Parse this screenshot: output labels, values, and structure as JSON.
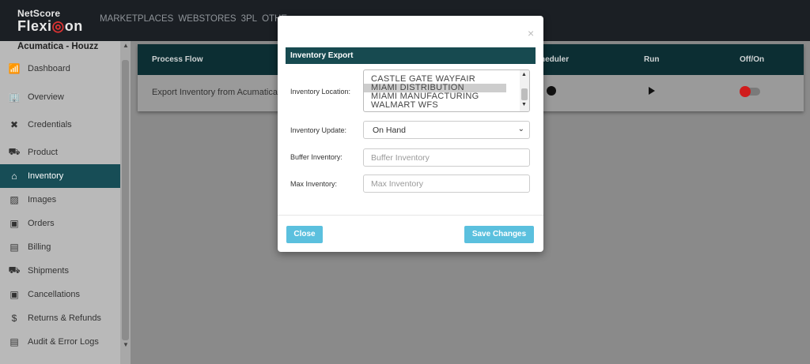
{
  "logo": {
    "line1": "NetScore",
    "line2_a": "Flexi",
    "line2_b": "on"
  },
  "topnav": [
    "MARKETPLACES",
    "WEBSTORES",
    "3PL",
    "OTHE"
  ],
  "sidebar": {
    "title": "Acumatica - Houzz",
    "items": [
      {
        "label": "Dashboard",
        "icon": "chart-icon"
      },
      {
        "label": "Overview",
        "icon": "building-icon"
      },
      {
        "label": "Credentials",
        "icon": "tools-icon"
      },
      {
        "label": "Product",
        "icon": "hand-truck-icon"
      },
      {
        "label": "Inventory",
        "icon": "warehouse-icon",
        "active": true
      },
      {
        "label": "Images",
        "icon": "image-icon"
      },
      {
        "label": "Orders",
        "icon": "box-icon"
      },
      {
        "label": "Billing",
        "icon": "ledger-icon"
      },
      {
        "label": "Shipments",
        "icon": "truck-icon"
      },
      {
        "label": "Cancellations",
        "icon": "box-cancel-icon"
      },
      {
        "label": "Returns & Refunds",
        "icon": "coin-icon"
      },
      {
        "label": "Audit & Error Logs",
        "icon": "log-icon"
      }
    ]
  },
  "table": {
    "headers": {
      "process_flow": "Process Flow",
      "scheduler": "heduler",
      "run": "Run",
      "offon": "Off/On"
    },
    "row": {
      "process_flow": "Export Inventory from Acumatica"
    }
  },
  "modal": {
    "title": "Inventory Export",
    "location_label": "Inventory Location:",
    "location_options": [
      "CASTLE GATE WAYFAIR",
      "MIAMI DISTRIBUTION",
      "MIAMI MANUFACTURING",
      "WALMART WFS"
    ],
    "location_selected": "MIAMI DISTRIBUTION",
    "update_label": "Inventory Update:",
    "update_value": "On Hand",
    "buffer_label": "Buffer Inventory:",
    "buffer_placeholder": "Buffer Inventory",
    "max_label": "Max Inventory:",
    "max_placeholder": "Max Inventory",
    "close_label": "Close",
    "save_label": "Save Changes"
  }
}
